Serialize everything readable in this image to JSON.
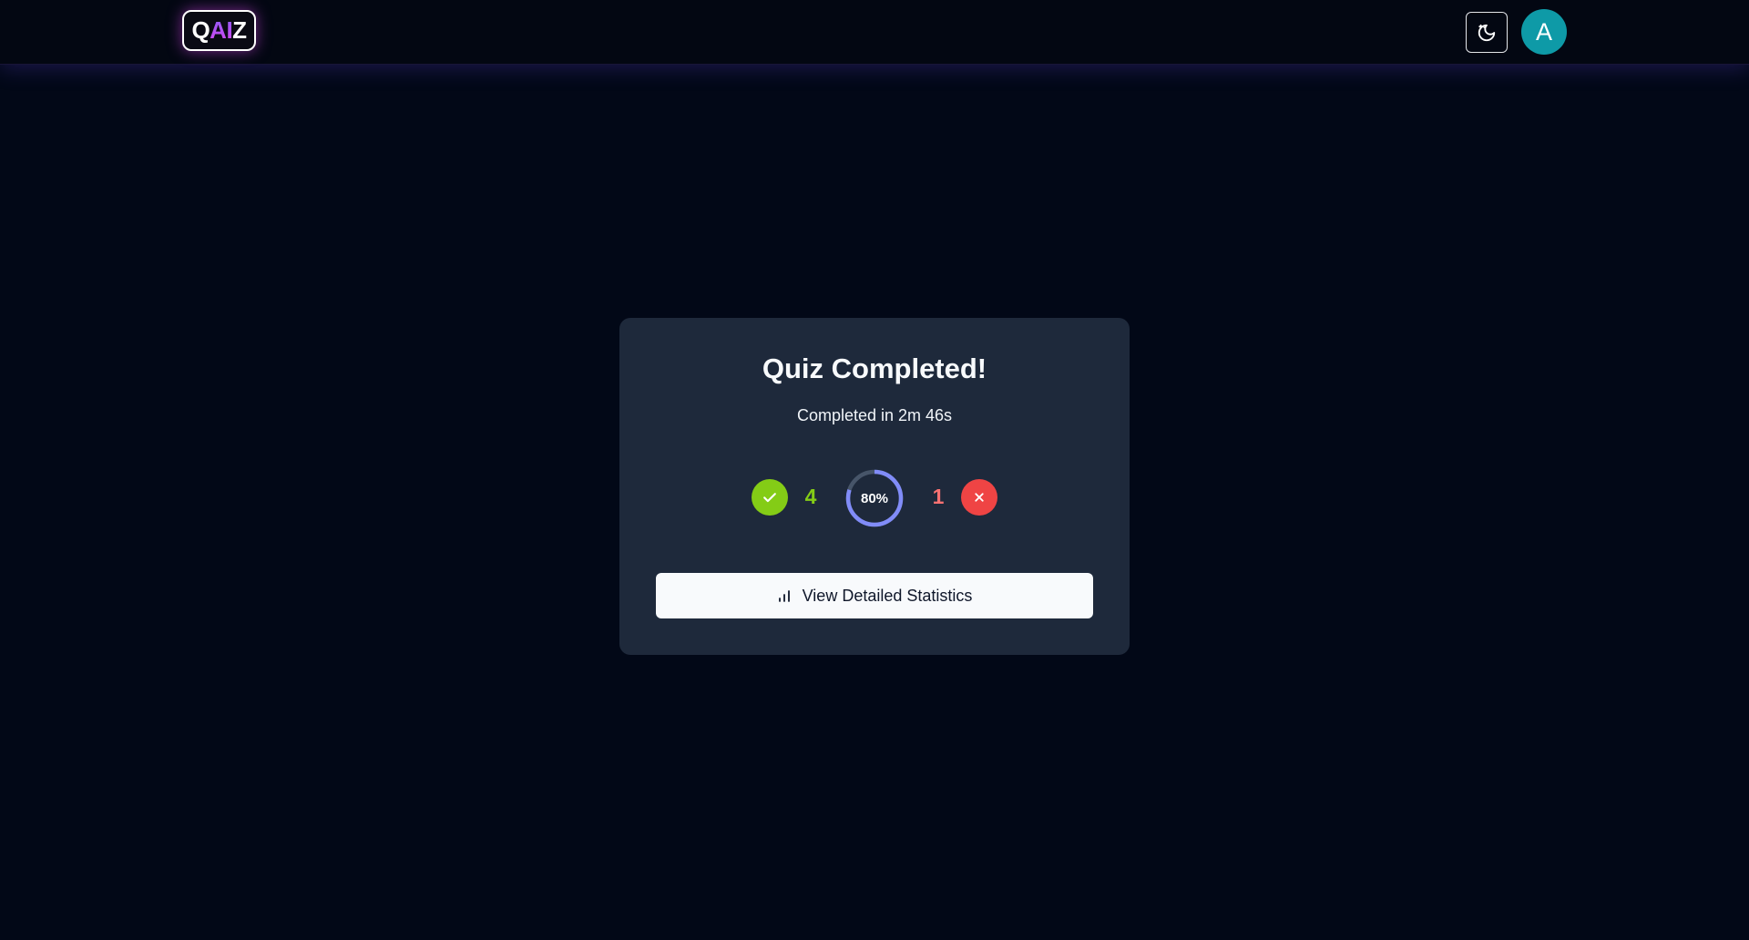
{
  "header": {
    "logo": {
      "q": "Q",
      "ai": "AI",
      "z": "Z"
    },
    "theme_toggle_icon": "moon-icon",
    "avatar_initial": "A"
  },
  "result": {
    "title": "Quiz Completed!",
    "subtitle": "Completed in 2m 46s",
    "correct_count": "4",
    "wrong_count": "1",
    "score_label": "80%",
    "score_fraction": 0.8,
    "details_button_label": "View Detailed Statistics",
    "details_button_icon": "bar-chart-icon"
  },
  "colors": {
    "background": "#020817",
    "card": "#1e293b",
    "correct": "#84cc16",
    "wrong": "#ef4444",
    "progress": "#818cf8",
    "avatar": "#0e9aa7"
  }
}
